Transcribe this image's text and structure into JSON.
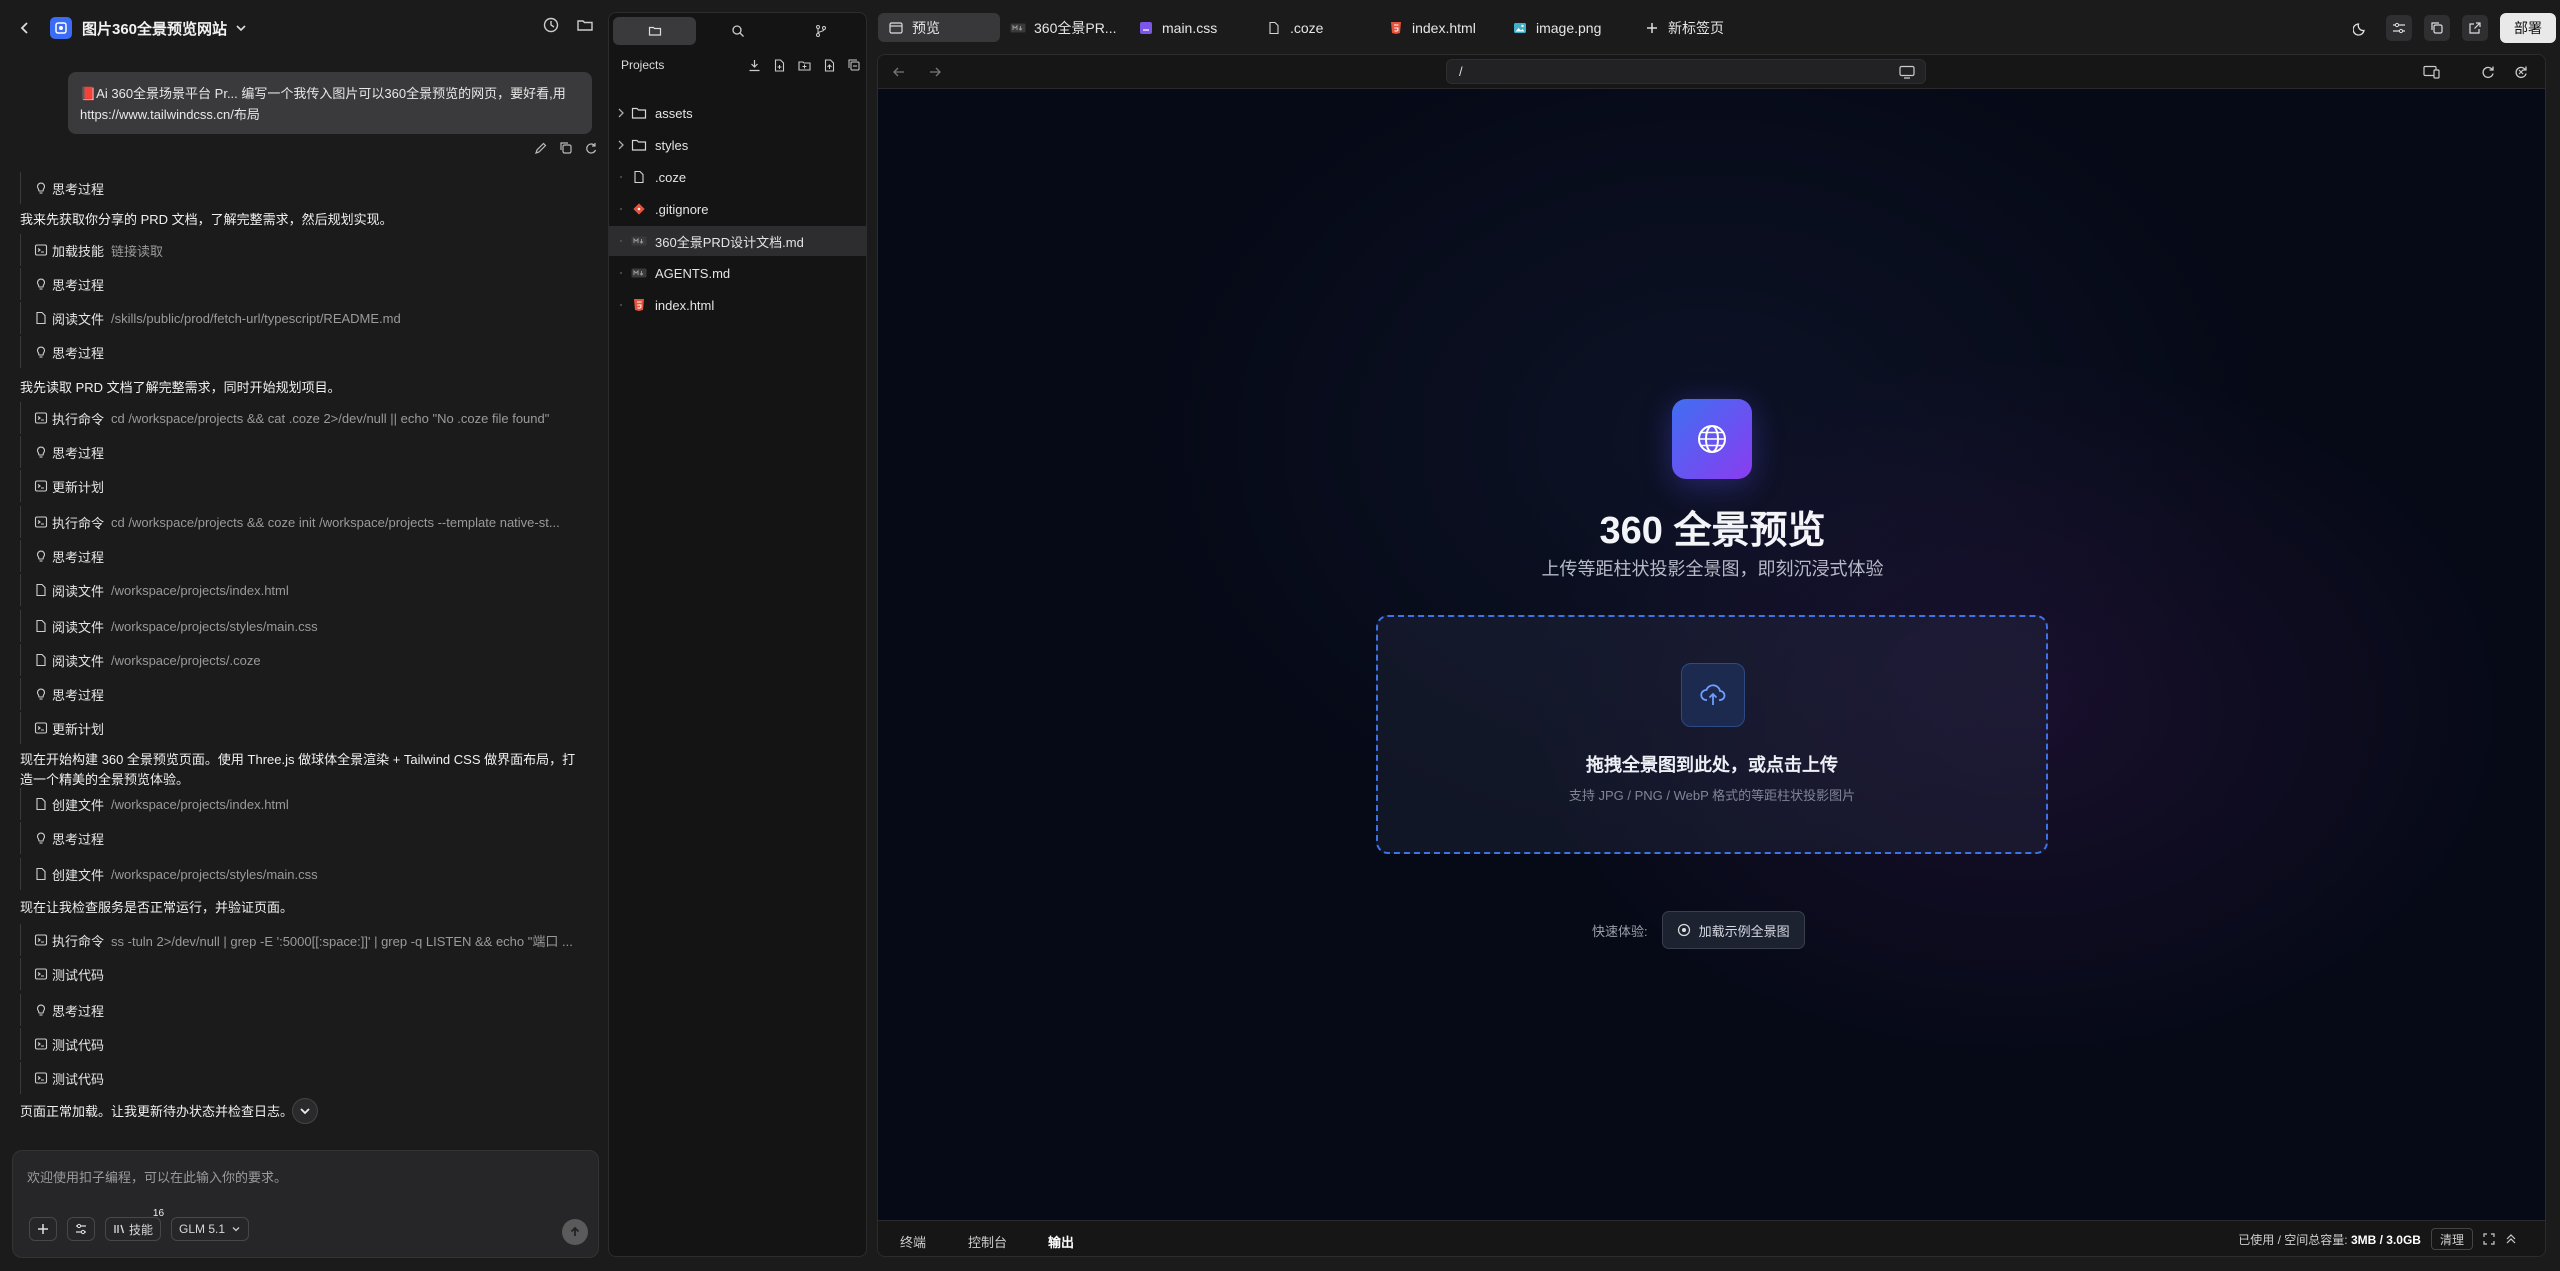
{
  "chat": {
    "project_title": "图片360全景预览网站",
    "prompt": "📕Ai 360全景场景平台 Pr...   编写一个我传入图片可以360全景预览的网页，要好看,用https://www.tailwindcss.cn/布局",
    "log": [
      {
        "kind": "step",
        "icon": "bulb",
        "label": "思考过程",
        "arg": ""
      },
      {
        "kind": "msg",
        "text": "我来先获取你分享的 PRD 文档，了解完整需求，然后规划实现。"
      },
      {
        "kind": "step",
        "icon": "terminal",
        "label": "加载技能",
        "arg": "链接读取"
      },
      {
        "kind": "step",
        "icon": "bulb",
        "label": "思考过程",
        "arg": ""
      },
      {
        "kind": "step",
        "icon": "file",
        "label": "阅读文件",
        "arg": "/skills/public/prod/fetch-url/typescript/README.md"
      },
      {
        "kind": "step",
        "icon": "bulb",
        "label": "思考过程",
        "arg": ""
      },
      {
        "kind": "msg",
        "text": "我先读取 PRD 文档了解完整需求，同时开始规划项目。"
      },
      {
        "kind": "step",
        "icon": "terminal",
        "label": "执行命令",
        "arg": "cd /workspace/projects && cat .coze 2>/dev/null || echo \"No .coze file found\""
      },
      {
        "kind": "step",
        "icon": "bulb",
        "label": "思考过程",
        "arg": ""
      },
      {
        "kind": "step",
        "icon": "terminal",
        "label": "更新计划",
        "arg": ""
      },
      {
        "kind": "step",
        "icon": "terminal",
        "label": "执行命令",
        "arg": "cd /workspace/projects && coze init /workspace/projects --template native-st..."
      },
      {
        "kind": "step",
        "icon": "bulb",
        "label": "思考过程",
        "arg": ""
      },
      {
        "kind": "step",
        "icon": "file",
        "label": "阅读文件",
        "arg": "/workspace/projects/index.html"
      },
      {
        "kind": "step",
        "icon": "file",
        "label": "阅读文件",
        "arg": "/workspace/projects/styles/main.css"
      },
      {
        "kind": "step",
        "icon": "file",
        "label": "阅读文件",
        "arg": "/workspace/projects/.coze"
      },
      {
        "kind": "step",
        "icon": "bulb",
        "label": "思考过程",
        "arg": ""
      },
      {
        "kind": "step",
        "icon": "terminal",
        "label": "更新计划",
        "arg": ""
      },
      {
        "kind": "msg2",
        "text": "现在开始构建 360 全景预览页面。使用 Three.js 做球体全景渲染 + Tailwind CSS 做界面布局，打",
        "text2": "造一个精美的全景预览体验。"
      },
      {
        "kind": "step",
        "icon": "file",
        "label": "创建文件",
        "arg": "/workspace/projects/index.html"
      },
      {
        "kind": "step",
        "icon": "bulb",
        "label": "思考过程",
        "arg": ""
      },
      {
        "kind": "step",
        "icon": "file",
        "label": "创建文件",
        "arg": "/workspace/projects/styles/main.css"
      },
      {
        "kind": "msg",
        "text": "现在让我检查服务是否正常运行，并验证页面。"
      },
      {
        "kind": "step",
        "icon": "terminal",
        "label": "执行命令",
        "arg": "ss -tuln 2>/dev/null | grep -E ':5000[[:space:]]' | grep -q LISTEN && echo \"端口 ..."
      },
      {
        "kind": "step",
        "icon": "terminal",
        "label": "测试代码",
        "arg": ""
      },
      {
        "kind": "step",
        "icon": "bulb",
        "label": "思考过程",
        "arg": ""
      },
      {
        "kind": "step",
        "icon": "terminal",
        "label": "测试代码",
        "arg": ""
      },
      {
        "kind": "step",
        "icon": "terminal",
        "label": "测试代码",
        "arg": ""
      },
      {
        "kind": "msg",
        "text": "页面正常加载。让我更新待办状态并检查日志。"
      }
    ],
    "composer": {
      "placeholder": "欢迎使用扣子编程，可以在此输入你的要求。",
      "skills_label": "技能",
      "skills_count": "16",
      "model": "GLM 5.1"
    }
  },
  "tree": {
    "header": "Projects",
    "items": [
      {
        "name": "assets",
        "type": "folder",
        "selected": false
      },
      {
        "name": "styles",
        "type": "folder",
        "selected": false
      },
      {
        "name": ".coze",
        "type": "file",
        "selected": false
      },
      {
        "name": ".gitignore",
        "type": "git",
        "selected": false
      },
      {
        "name": "360全景PRD设计文档.md",
        "type": "md",
        "selected": true
      },
      {
        "name": "AGENTS.md",
        "type": "md",
        "selected": false
      },
      {
        "name": "index.html",
        "type": "html",
        "selected": false
      }
    ]
  },
  "tabs": [
    {
      "label": "预览",
      "icon": "preview",
      "active": true
    },
    {
      "label": "360全景PR...",
      "icon": "md",
      "active": false
    },
    {
      "label": "main.css",
      "icon": "css",
      "active": false
    },
    {
      "label": ".coze",
      "icon": "file",
      "active": false
    },
    {
      "label": "index.html",
      "icon": "html",
      "active": false
    },
    {
      "label": "image.png",
      "icon": "image",
      "active": false
    },
    {
      "label": "新标签页",
      "icon": "plus",
      "active": false
    }
  ],
  "deploy_label": "部署",
  "browser": {
    "address": "/",
    "page": {
      "title": "360 全景预览",
      "subtitle": "上传等距柱状投影全景图，即刻沉浸式体验",
      "drop_title": "拖拽全景图到此处，或点击上传",
      "drop_sub": "支持 JPG / PNG / WebP 格式的等距柱状投影图片",
      "quick_label": "快速体验:",
      "sample_button": "加载示例全景图"
    },
    "bottom_tabs": [
      "终端",
      "控制台",
      "输出"
    ],
    "active_bottom_tab": "输出",
    "storage_label": "已使用 / 空间总容量:",
    "storage_value": "3MB / 3.0GB",
    "clear_label": "清理"
  },
  "colors": {
    "accent_blue": "#3e73e8",
    "hero_gradient_start": "#3f6ff2",
    "hero_gradient_end": "#8a3cf0",
    "git_icon": "#e5533d",
    "html_icon": "#e5533d",
    "css_icon": "#7b56e8",
    "image_icon": "#3fb0c9"
  }
}
